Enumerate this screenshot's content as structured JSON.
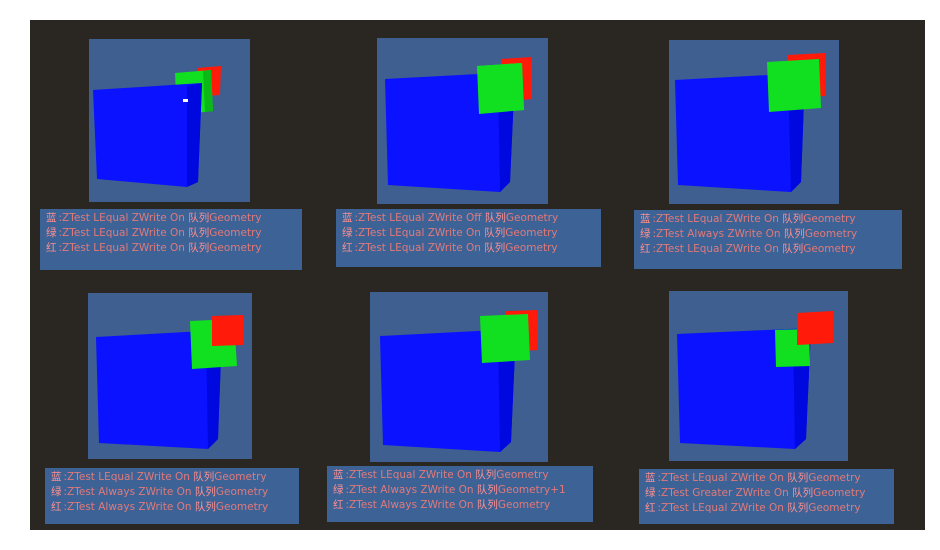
{
  "colors": {
    "frame_bg": "#2a2622",
    "viewport_bg": "#3e5f90",
    "legend_bg": "#3d6296",
    "text": "#e07a7a",
    "blue_cube": "#0a12ff",
    "green_cube": "#10e020",
    "red_cube": "#ff1a0a"
  },
  "panels": [
    {
      "lines": [
        {
          "label": "蓝",
          "text": ":ZTest LEqual ZWrite On",
          "queue": "队列",
          "queue_value": "Geometry"
        },
        {
          "label": "绿",
          "text": ":ZTest LEqual ZWrite On",
          "queue": "队列",
          "queue_value": "Geometry"
        },
        {
          "label": "红",
          "text": ":ZTest LEqual ZWrite On",
          "queue": "队列",
          "queue_value": "Geometry"
        }
      ]
    },
    {
      "lines": [
        {
          "label": "蓝",
          "text": ":ZTest LEqual ZWrite Off",
          "queue": "队列",
          "queue_value": "Geometry"
        },
        {
          "label": "绿",
          "text": ":ZTest LEqual ZWrite On",
          "queue": "队列",
          "queue_value": "Geometry"
        },
        {
          "label": "红",
          "text": ":ZTest LEqual ZWrite On",
          "queue": "队列",
          "queue_value": "Geometry"
        }
      ]
    },
    {
      "lines": [
        {
          "label": "蓝",
          "text": ":ZTest LEqual ZWrite On",
          "queue": "队列",
          "queue_value": "Geometry"
        },
        {
          "label": "绿",
          "text": ":ZTest Always ZWrite On",
          "queue": "队列",
          "queue_value": "Geometry"
        },
        {
          "label": "红",
          "text": ":ZTest LEqual ZWrite On",
          "queue": "队列",
          "queue_value": "Geometry"
        }
      ]
    },
    {
      "lines": [
        {
          "label": "蓝",
          "text": ":ZTest LEqual ZWrite On",
          "queue": "队列",
          "queue_value": "Geometry"
        },
        {
          "label": "绿",
          "text": ":ZTest Always ZWrite On",
          "queue": "队列",
          "queue_value": "Geometry"
        },
        {
          "label": "红",
          "text": ":ZTest Always ZWrite On",
          "queue": "队列",
          "queue_value": "Geometry"
        }
      ]
    },
    {
      "lines": [
        {
          "label": "蓝",
          "text": ":ZTest LEqual ZWrite On",
          "queue": "队列",
          "queue_value": "Geometry"
        },
        {
          "label": "绿",
          "text": ":ZTest Always ZWrite On",
          "queue": "队列",
          "queue_value": "Geometry+1"
        },
        {
          "label": "红",
          "text": ":ZTest Always ZWrite On",
          "queue": "队列",
          "queue_value": "Geometry"
        }
      ]
    },
    {
      "lines": [
        {
          "label": "蓝",
          "text": ":ZTest LEqual ZWrite On",
          "queue": "队列",
          "queue_value": "Geometry"
        },
        {
          "label": "绿",
          "text": ":ZTest Greater ZWrite On",
          "queue": "队列",
          "queue_value": "Geometry"
        },
        {
          "label": "红",
          "text": ":ZTest LEqual ZWrite On",
          "queue": "队列",
          "queue_value": "Geometry"
        }
      ]
    }
  ]
}
